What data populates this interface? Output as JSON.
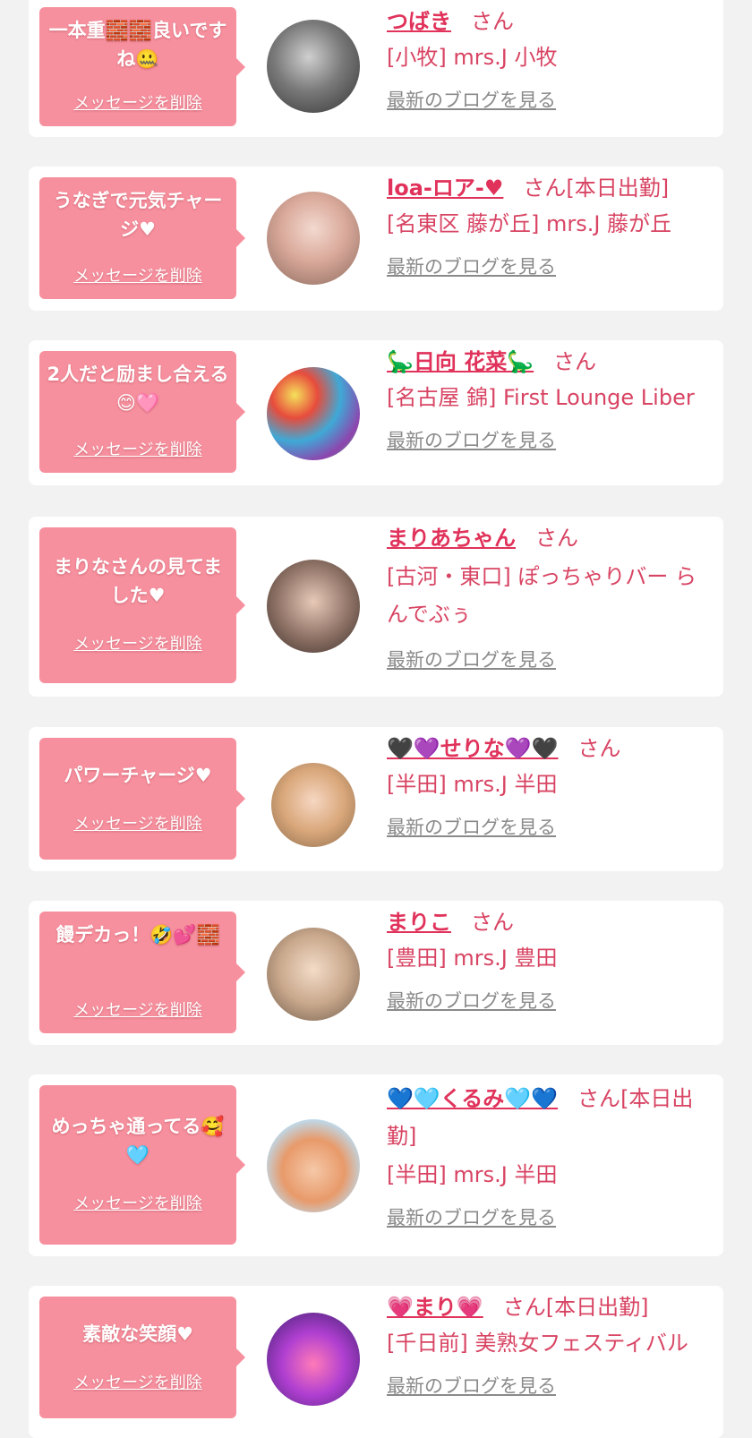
{
  "delete_label": "メッセージを削除",
  "blog_label": "最新のブログを見る",
  "san_label": "さん",
  "colors": {
    "background": "#f2f2f2",
    "bubble": "#f7909e",
    "accent": "#e0325a",
    "link_gray": "#8a8a8a"
  },
  "cards": [
    {
      "message": "一本重🧱🧱良いですね🤐",
      "name": "つばき",
      "status": "",
      "shop": "[小牧] mrs.J 小牧",
      "avatar_icon": "avatar-photo-1"
    },
    {
      "message": "うなぎで元気チャージ♥",
      "name": "loa-ロア-♥",
      "status": "[本日出勤]",
      "shop": "[名東区 藤が丘] mrs.J 藤が丘",
      "avatar_icon": "avatar-photo-2"
    },
    {
      "message": "2人だと励まし合える😊🩷",
      "name": "🦕日向 花菜🦕",
      "status": "",
      "shop": "[名古屋 錦] First Lounge Liber",
      "avatar_icon": "avatar-photo-3"
    },
    {
      "message": "まりなさんの見てました♥",
      "name": "まりあちゃん",
      "status": "",
      "shop": "[古河・東口] ぽっちゃりバー らんでぶぅ",
      "avatar_icon": "avatar-photo-4"
    },
    {
      "message": "パワーチャージ♥",
      "name": "🖤💜せりな💜🖤",
      "status": "",
      "shop": "[半田] mrs.J 半田",
      "avatar_icon": "avatar-photo-5"
    },
    {
      "message": "饅デカっ！🤣💕🧱",
      "name": "まりこ",
      "status": "",
      "shop": "[豊田] mrs.J 豊田",
      "avatar_icon": "avatar-photo-6"
    },
    {
      "message": "めっちゃ通ってる🥰🩵",
      "name": "💙🩵くるみ🩵💙",
      "status": "[本日出勤]",
      "shop": "[半田] mrs.J 半田",
      "avatar_icon": "avatar-photo-7"
    },
    {
      "message": "素敵な笑顔♥",
      "name": "💗まり💗",
      "status": "[本日出勤]",
      "shop": "[千日前] 美熟女フェスティバル",
      "avatar_icon": "avatar-photo-8"
    }
  ]
}
